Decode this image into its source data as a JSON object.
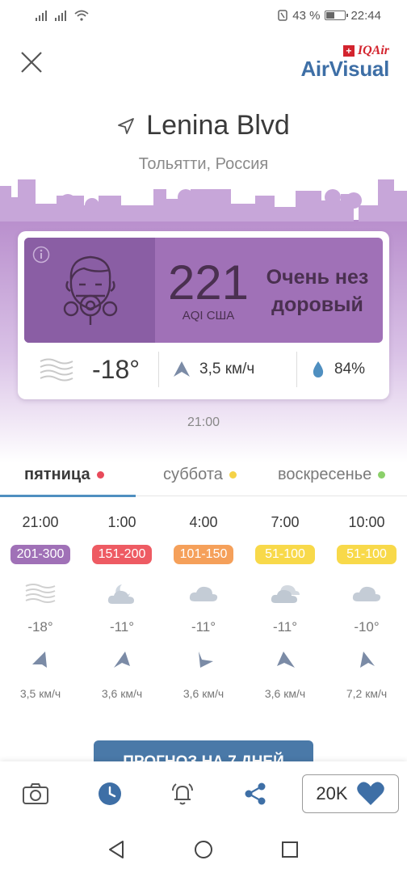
{
  "status_bar": {
    "battery_text": "43 %",
    "time": "22:44"
  },
  "header": {
    "brand_top": "IQAir",
    "brand_name": "AirVisual",
    "flag_symbol": "+"
  },
  "location": {
    "name": "Lenina Blvd",
    "subtitle": "Тольятти, Россия"
  },
  "current": {
    "aqi": "221",
    "aqi_unit": "AQI США",
    "status_line1": "Очень нез",
    "status_line2": "доровый",
    "temperature": "-18°",
    "wind": "3,5 км/ч",
    "humidity": "84%",
    "time": "21:00",
    "aqi_color": "#a071b7"
  },
  "tabs": [
    {
      "label": "пятница",
      "dot_color": "#e84a5a",
      "active": true
    },
    {
      "label": "суббота",
      "dot_color": "#f5d247",
      "active": false
    },
    {
      "label": "воскресенье",
      "dot_color": "#8bd06a",
      "active": false
    }
  ],
  "forecast": [
    {
      "time": "21:00",
      "aqi_range": "201-300",
      "badge_color": "#a071b7",
      "weather_icon": "fog-icon",
      "temp": "-18°",
      "wind": "3,5 км/ч"
    },
    {
      "time": "1:00",
      "aqi_range": "151-200",
      "badge_color": "#ee5b63",
      "weather_icon": "moon-cloud-icon",
      "temp": "-11°",
      "wind": "3,6 км/ч"
    },
    {
      "time": "4:00",
      "aqi_range": "101-150",
      "badge_color": "#f5a05a",
      "weather_icon": "cloud-icon",
      "temp": "-11°",
      "wind": "3,6 км/ч"
    },
    {
      "time": "7:00",
      "aqi_range": "51-100",
      "badge_color": "#f8d94a",
      "weather_icon": "clouds-icon",
      "temp": "-11°",
      "wind": "3,6 км/ч"
    },
    {
      "time": "10:00",
      "aqi_range": "51-100",
      "badge_color": "#f8d94a",
      "weather_icon": "cloud-icon",
      "temp": "-10°",
      "wind": "7,2 км/ч"
    }
  ],
  "forecast_button": "ПРОГНОЗ НА 7 ДНЕЙ",
  "bottom_bar": {
    "likes": "20K"
  },
  "colors": {
    "accent_blue": "#4f8fc0",
    "purple_dark": "#8a5ea4",
    "skyline": "#c7a6d9"
  }
}
